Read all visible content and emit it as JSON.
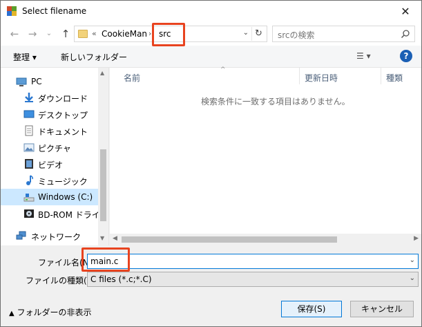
{
  "window": {
    "title": "Select filename",
    "close_glyph": "✕"
  },
  "nav": {
    "back_glyph": "←",
    "forward_glyph": "→",
    "recent_glyph": "⌄",
    "up_glyph": "↑",
    "breadcrumb_overflow": "«",
    "breadcrumb": [
      "CookieMan",
      "src"
    ],
    "breadcrumb_sep": "›",
    "address_dropdown_glyph": "⌄",
    "refresh_glyph": "↻",
    "search_placeholder": "srcの検索"
  },
  "toolbar": {
    "organize_label": "整理 ▾",
    "new_folder_label": "新しいフォルダー",
    "view_label": "☰ ▾",
    "help_label": "?"
  },
  "sidebar": {
    "items": [
      {
        "label": "PC",
        "icon": "pc-icon"
      },
      {
        "label": "ダウンロード",
        "icon": "download-icon"
      },
      {
        "label": "デスクトップ",
        "icon": "desktop-icon"
      },
      {
        "label": "ドキュメント",
        "icon": "document-icon"
      },
      {
        "label": "ピクチャ",
        "icon": "picture-icon"
      },
      {
        "label": "ビデオ",
        "icon": "video-icon"
      },
      {
        "label": "ミュージック",
        "icon": "music-icon"
      },
      {
        "label": "Windows (C:)",
        "icon": "drive-icon",
        "selected": true
      },
      {
        "label": "BD-ROM ドライブ",
        "icon": "bd-rom-icon"
      },
      {
        "label": "ネットワーク",
        "icon": "network-icon"
      }
    ]
  },
  "filelist": {
    "columns": [
      "名前",
      "更新日時",
      "種類"
    ],
    "sort_glyph": "^",
    "empty_message": "検索条件に一致する項目はありません。"
  },
  "form": {
    "filename_label": "ファイル名(N):",
    "filename_value": "main.c",
    "filetype_label": "ファイルの種類(T):",
    "filetype_value": "C files (*.c;*.C)",
    "dropdown_glyph": "⌄"
  },
  "footer": {
    "hide_folders_label": "フォルダーの非表示",
    "save_label": "保存(S)",
    "cancel_label": "キャンセル"
  },
  "colors": {
    "highlight": "#e8431f",
    "selection": "#cce8ff",
    "accent": "#0078d7"
  }
}
